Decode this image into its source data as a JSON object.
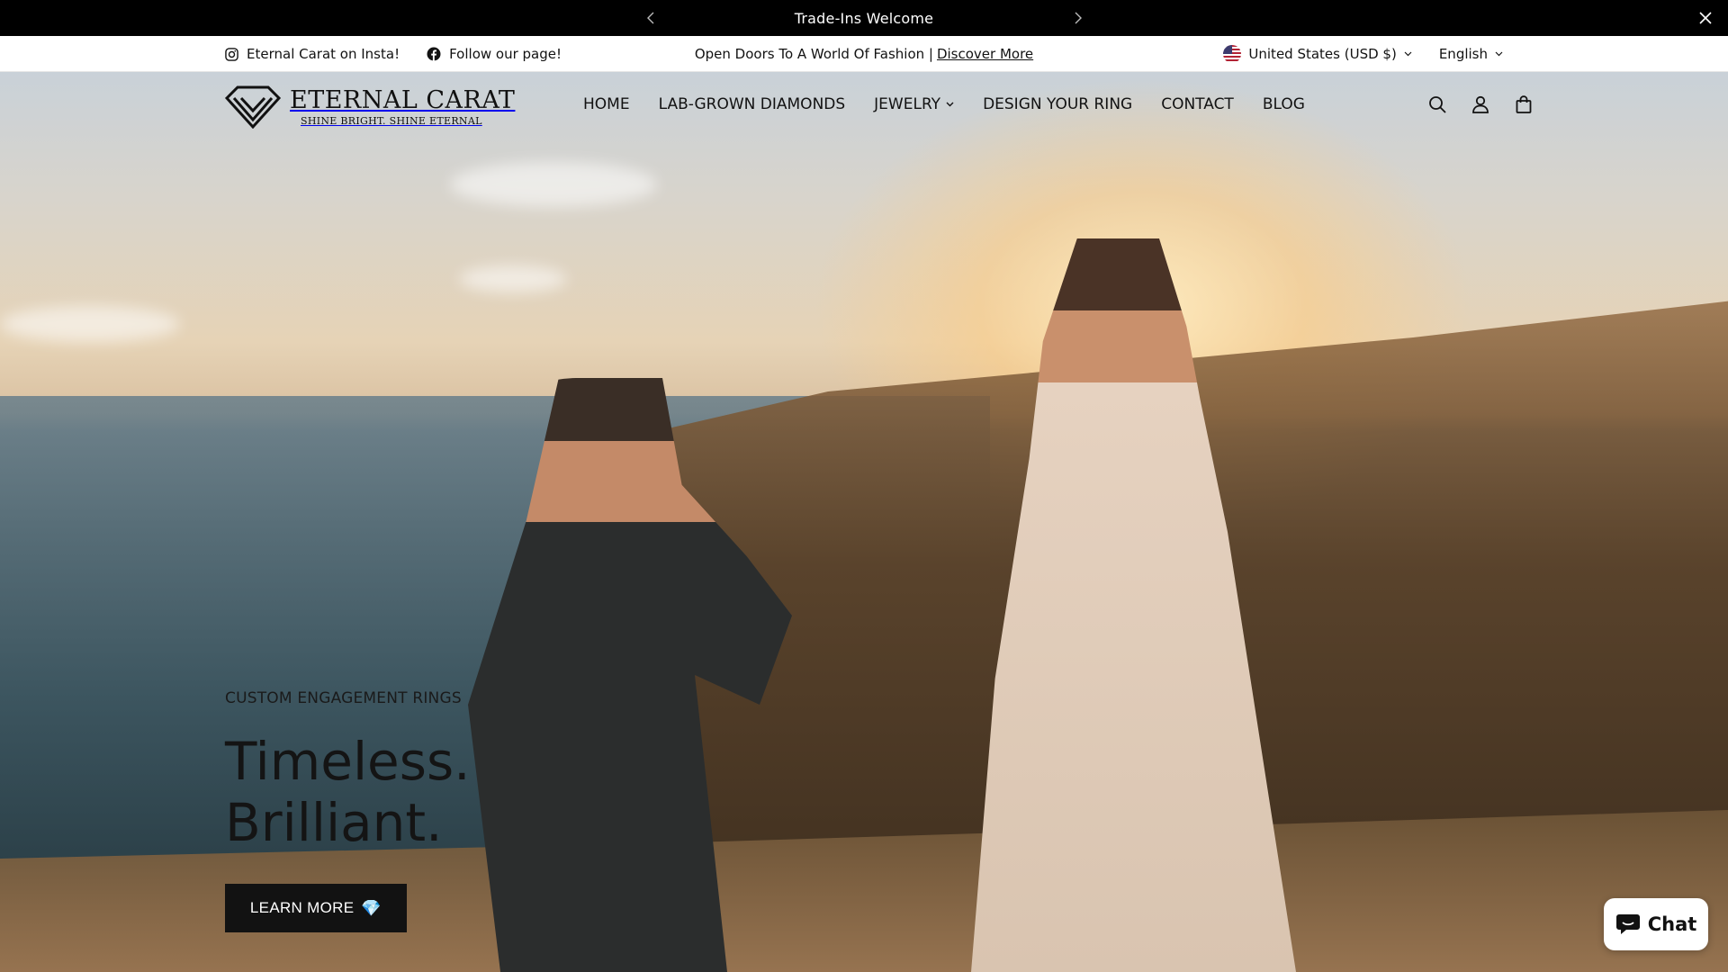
{
  "announcement": {
    "text": "Trade-Ins Welcome"
  },
  "utility": {
    "instagram_label": "Eternal Carat on Insta!",
    "facebook_label": "Follow our page!",
    "promo_text": "Open Doors To A World Of Fashion |",
    "promo_link": "Discover More",
    "country": "United States (USD $)",
    "language": "English"
  },
  "header": {
    "brand": "ETERNAL CARAT",
    "tagline": "SHINE BRIGHT. SHINE ETERNAL",
    "nav": [
      "HOME",
      "LAB-GROWN DIAMONDS",
      "JEWELRY",
      "DESIGN YOUR RING",
      "CONTACT",
      "BLOG"
    ]
  },
  "hero": {
    "eyebrow": "CUSTOM ENGAGEMENT RINGS",
    "headline_line1": "Timeless.",
    "headline_line2": "Brilliant.",
    "cta_label": "LEARN MORE",
    "cta_gem": "💎"
  },
  "chat": {
    "label": "Chat"
  },
  "colors": {
    "bar": "#000000",
    "text": "#121212",
    "cta": "#121212"
  }
}
